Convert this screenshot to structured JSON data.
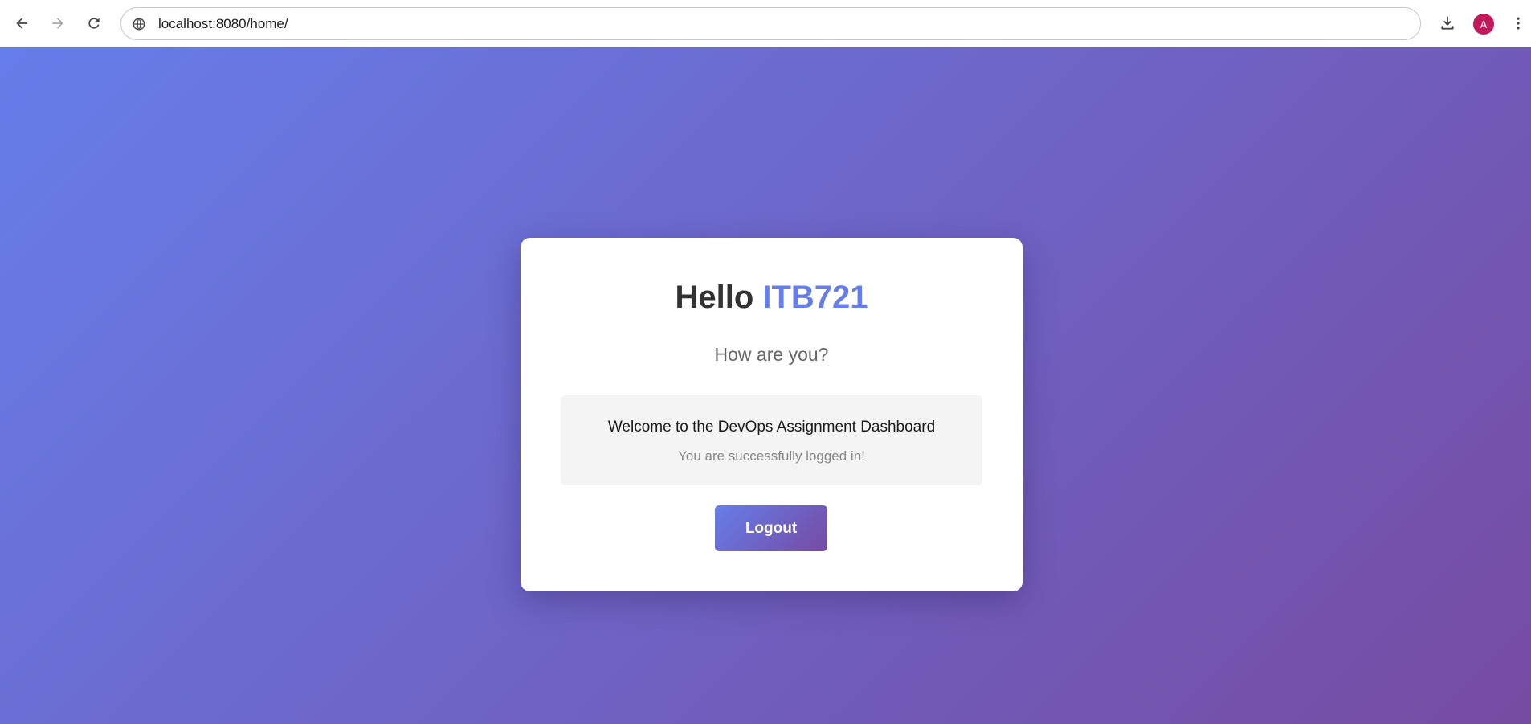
{
  "browser": {
    "url": "localhost:8080/home/",
    "profile_initial": "A",
    "icons": {
      "back": "arrow-left-icon",
      "forward": "arrow-right-icon",
      "reload": "reload-icon",
      "site_info": "globe-icon",
      "download": "download-icon",
      "menu": "kebab-menu-icon"
    }
  },
  "page": {
    "greeting_prefix": "Hello",
    "username": "ITB721",
    "subtitle": "How are you?",
    "welcome_title": "Welcome to the DevOps Assignment Dashboard",
    "welcome_message": "You are successfully logged in!",
    "logout_label": "Logout"
  },
  "colors": {
    "gradient_start": "#667eea",
    "gradient_end": "#764ba2",
    "username_color": "#667eea",
    "avatar_bg": "#c2185b"
  }
}
